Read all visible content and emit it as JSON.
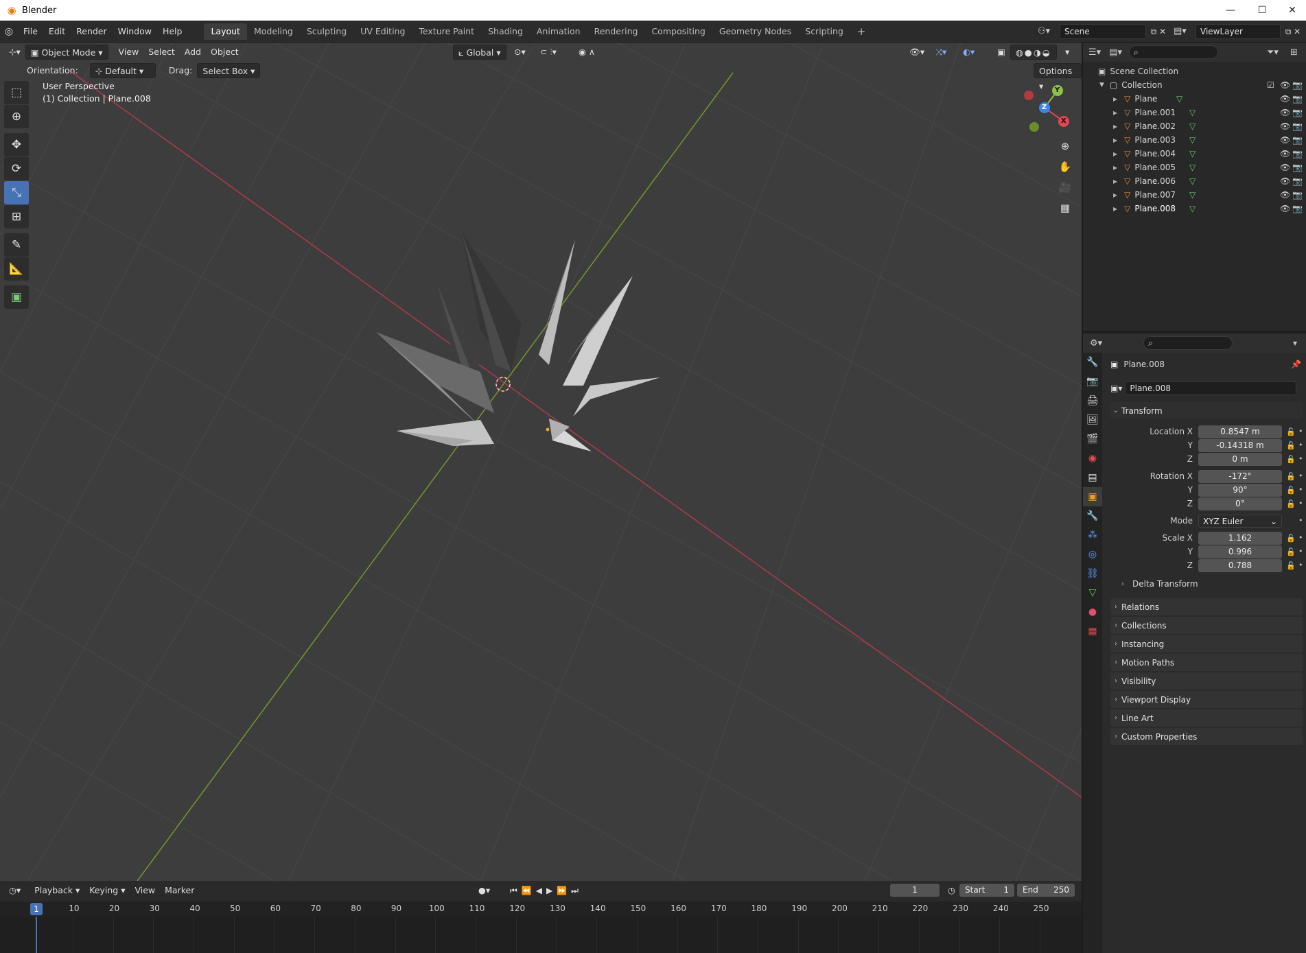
{
  "app": {
    "title": "Blender"
  },
  "menu": [
    "File",
    "Edit",
    "Render",
    "Window",
    "Help"
  ],
  "workspaces": [
    "Layout",
    "Modeling",
    "Sculpting",
    "UV Editing",
    "Texture Paint",
    "Shading",
    "Animation",
    "Rendering",
    "Compositing",
    "Geometry Nodes",
    "Scripting"
  ],
  "scene": {
    "name": "Scene",
    "view_layer": "ViewLayer"
  },
  "viewport": {
    "mode": "Object Mode",
    "menus": [
      "View",
      "Select",
      "Add",
      "Object"
    ],
    "transform_orientation": "Global",
    "orientation_label": "Orientation:",
    "orientation_value": "Default",
    "drag_label": "Drag:",
    "drag_value": "Select Box",
    "options_label": "Options",
    "info_line1": "User Perspective",
    "info_line2": "(1) Collection | Plane.008",
    "gizmo": {
      "x": "X",
      "y": "Y",
      "z": "Z"
    }
  },
  "outliner": {
    "scene_collection": "Scene Collection",
    "collection": "Collection",
    "objects": [
      "Plane",
      "Plane.001",
      "Plane.002",
      "Plane.003",
      "Plane.004",
      "Plane.005",
      "Plane.006",
      "Plane.007",
      "Plane.008"
    ]
  },
  "properties": {
    "object_name": "Plane.008",
    "object_field": "Plane.008",
    "transform_label": "Transform",
    "location_label": "Location X",
    "location": [
      "0.8547 m",
      "-0.14318 m",
      "0 m"
    ],
    "rotation_label": "Rotation X",
    "rotation": [
      "-172°",
      "90°",
      "0°"
    ],
    "mode_label": "Mode",
    "mode_value": "XYZ Euler",
    "scale_label": "Scale X",
    "scale": [
      "1.162",
      "0.996",
      "0.788"
    ],
    "axis_y": "Y",
    "axis_z": "Z",
    "delta_transform": "Delta Transform",
    "panels": [
      "Relations",
      "Collections",
      "Instancing",
      "Motion Paths",
      "Visibility",
      "Viewport Display",
      "Line Art",
      "Custom Properties"
    ]
  },
  "timeline": {
    "menus": [
      "Playback",
      "Keying",
      "View",
      "Marker"
    ],
    "current_frame": "1",
    "start_label": "Start",
    "start": "1",
    "end_label": "End",
    "end": "250",
    "ticks": [
      "10",
      "20",
      "30",
      "40",
      "50",
      "60",
      "70",
      "80",
      "90",
      "100",
      "110",
      "120",
      "130",
      "140",
      "150",
      "160",
      "170",
      "180",
      "190",
      "200",
      "210",
      "220",
      "230",
      "240",
      "250"
    ],
    "playhead": "1"
  }
}
